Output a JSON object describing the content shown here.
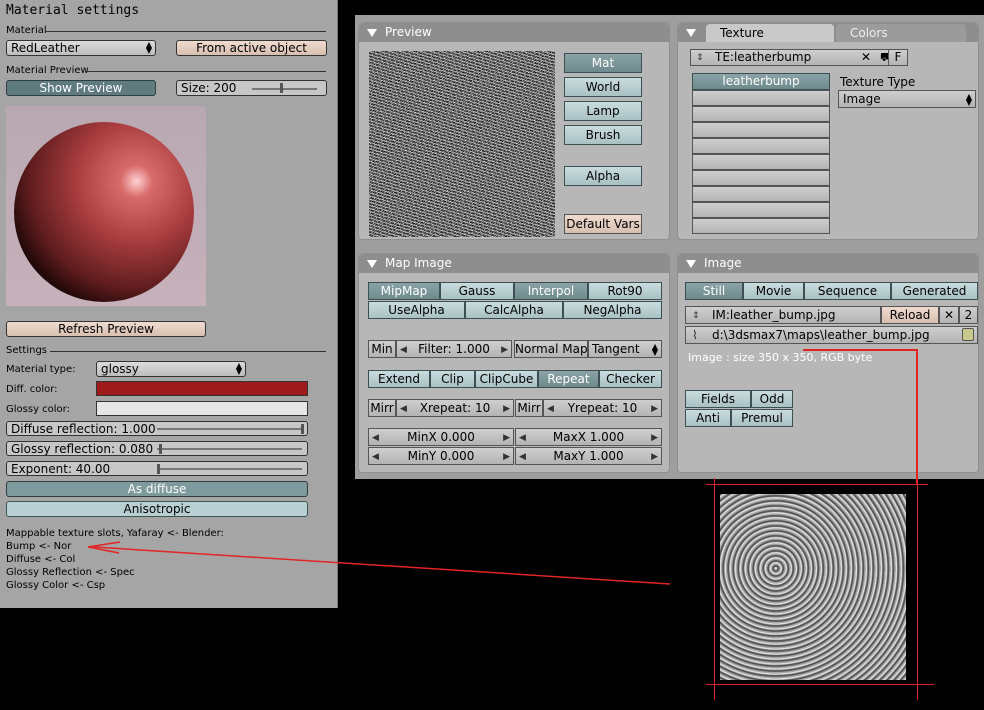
{
  "left": {
    "title": "Material settings",
    "material_label": "Material",
    "material_value": "RedLeather",
    "from_active": "From active object",
    "preview_label": "Material Preview",
    "show_preview": "Show Preview",
    "size": "Size: 200",
    "refresh": "Refresh Preview",
    "settings_label": "Settings",
    "material_type_label": "Material type:",
    "material_type_value": "glossy",
    "diff_color_label": "Diff. color:",
    "diff_color": "#9f1b1b",
    "glossy_color_label": "Glossy color:",
    "glossy_color": "#e6e6e6",
    "diffuse_reflection": "Diffuse reflection: 1.000",
    "glossy_reflection": "Glossy reflection: 0.080",
    "exponent": "Exponent: 40.00",
    "as_diffuse": "As diffuse",
    "anisotropic": "Anisotropic",
    "notes": [
      "Mappable texture slots, Yafaray <- Blender:",
      "Bump <- Nor",
      "Diffuse <- Col",
      "Glossy Reflection <- Spec",
      "Glossy Color <- Csp"
    ]
  },
  "preview": {
    "title": "Preview",
    "buttons": [
      "Mat",
      "World",
      "Lamp",
      "Brush"
    ],
    "alpha": "Alpha",
    "default_vars": "Default Vars"
  },
  "texture": {
    "tab_texture": "Texture",
    "tab_colors": "Colors",
    "name": "TE:leatherbump",
    "f_btn": "F",
    "slot_active": "leatherbump",
    "type_label": "Texture Type",
    "type_value": "Image"
  },
  "map_image": {
    "title": "Map Image",
    "row1": [
      "MipMap",
      "Gauss",
      "Interpol",
      "Rot90"
    ],
    "row2": [
      "UseAlpha",
      "CalcAlpha",
      "NegAlpha"
    ],
    "min": "Min",
    "filter": "Filter: 1.000",
    "normal_map": "Normal Map",
    "tangent": "Tangent",
    "extend_row": [
      "Extend",
      "Clip",
      "ClipCube",
      "Repeat",
      "Checker"
    ],
    "mirr": "Mirr",
    "xrepeat": "Xrepeat: 10",
    "yrepeat": "Yrepeat: 10",
    "minx": "MinX 0.000",
    "maxx": "MaxX 1.000",
    "miny": "MinY 0.000",
    "maxy": "MaxY 1.000"
  },
  "image": {
    "title": "Image",
    "tabs": [
      "Still",
      "Movie",
      "Sequence",
      "Generated"
    ],
    "im_name": "IM:leather_bump.jpg",
    "reload": "Reload",
    "users": "2",
    "path": "d:\\3dsmax7\\maps\\leather_bump.jpg",
    "info": "Image : size 350 x 350, RGB byte",
    "fields": "Fields",
    "odd": "Odd",
    "anti": "Anti",
    "premul": "Premul"
  }
}
